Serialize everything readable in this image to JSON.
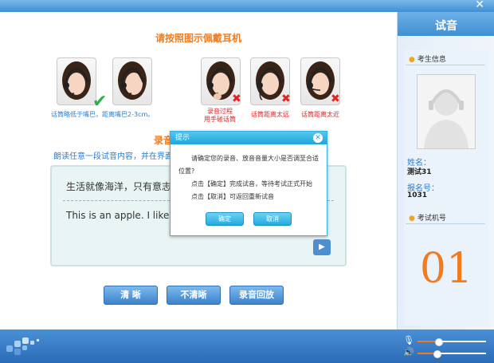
{
  "window": {
    "close_glyph": "✕"
  },
  "main": {
    "title": "请按照图示佩戴耳机",
    "photos": [
      {
        "caption": "话筒略低于嘴巴，距离嘴巴2-3cm。",
        "mark": "check"
      },
      {
        "caption": "",
        "mark": "none"
      },
      {
        "caption": "录音过程\n用手碰话筒",
        "mark": "cross"
      },
      {
        "caption": "话筒距离太远",
        "mark": "cross"
      },
      {
        "caption": "话筒距离太近",
        "mark": "cross"
      }
    ],
    "recording_title": "录音",
    "instruction": "朗读任意一段试音内容，并在界面",
    "reading_cn": "生活就像海洋，只有意志坚",
    "reading_en": "This is an apple. I like ap",
    "play_glyph": "▶",
    "buttons": {
      "clear": "清 晰",
      "unclear": "不清晰",
      "playback": "录音回放"
    }
  },
  "sidebar": {
    "title": "试音",
    "candidate_section": "考生信息",
    "name_label": "姓名：",
    "name_value": "测试31",
    "number_label": "报名号：",
    "number_value": "1031",
    "machine_section": "考试机号",
    "machine_number": "01"
  },
  "bottom": {
    "mic_icon": "mic-icon",
    "speaker_icon": "speaker-icon",
    "mic_level": 0.3,
    "speaker_level": 0.28
  },
  "dialog": {
    "title": "提示",
    "close_glyph": "✕",
    "line1": "请确定您的录音、放音音量大小是否调至合适",
    "line1b": "位置?",
    "line2": "点击【确定】完成试音，等待考试正式开始",
    "line3": "点击【取消】可返回重新试音",
    "ok": "确定",
    "cancel": "取消"
  },
  "colors": {
    "accent": "#f07c1f",
    "link": "#2c7ed0",
    "bar": "#3f8fd2"
  }
}
